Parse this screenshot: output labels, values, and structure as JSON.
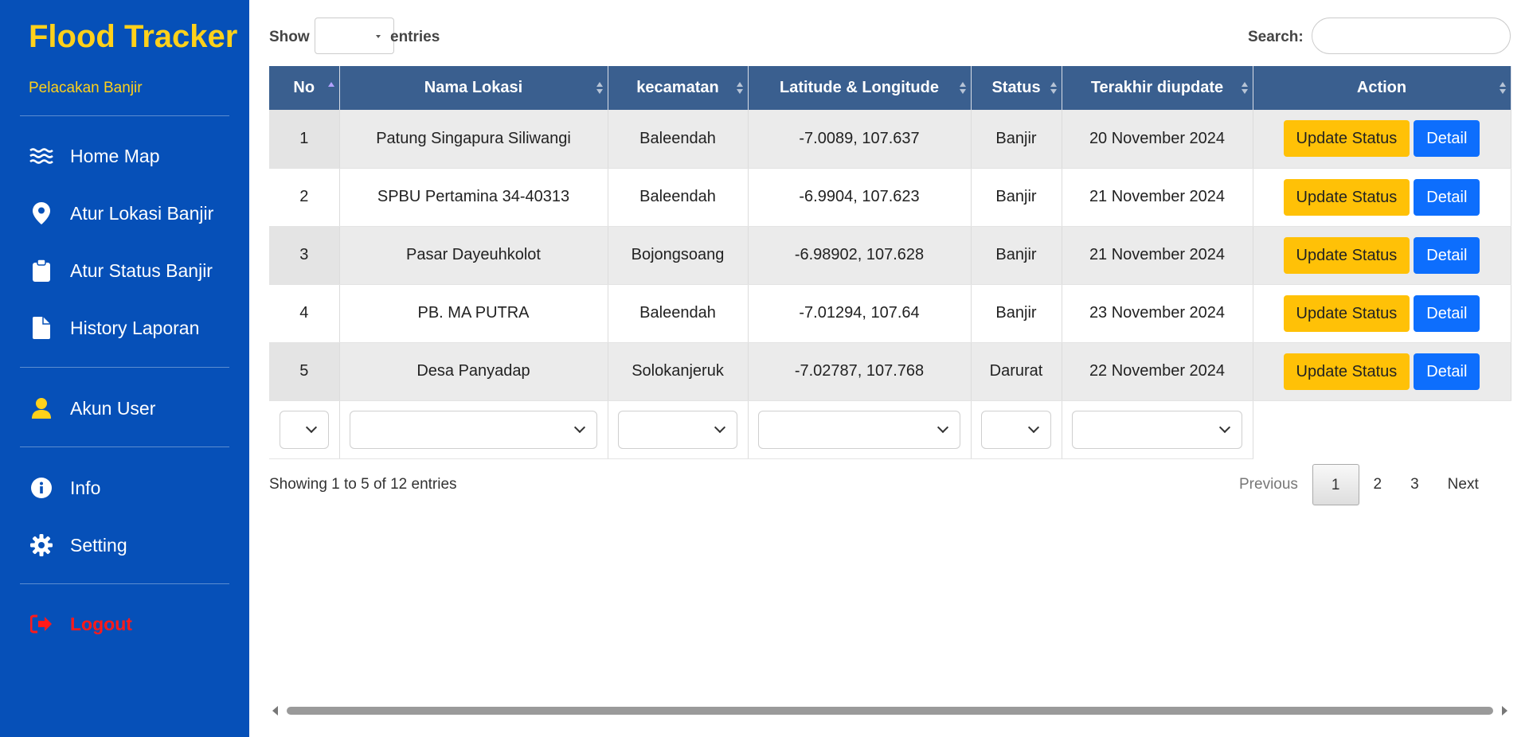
{
  "sidebar": {
    "brand": "Flood Tracker",
    "tagline": "Pelacakan Banjir",
    "items": [
      {
        "label": "Home Map",
        "icon": "water-waves-icon"
      },
      {
        "label": "Atur Lokasi Banjir",
        "icon": "location-pin-icon"
      },
      {
        "label": "Atur Status Banjir",
        "icon": "clipboard-icon"
      },
      {
        "label": "History Laporan",
        "icon": "document-icon"
      },
      {
        "label": "Akun User",
        "icon": "user-icon"
      },
      {
        "label": "Info",
        "icon": "info-circle-icon"
      },
      {
        "label": "Setting",
        "icon": "gear-icon"
      },
      {
        "label": "Logout",
        "icon": "sign-out-icon"
      }
    ],
    "colors": {
      "background": "#0650b8",
      "brand": "#ffd11a",
      "user_icon": "#ffd11a",
      "logout": "#ff1a1a"
    }
  },
  "table_controls": {
    "show_label": "Show",
    "entries_label": "entries",
    "page_length": "",
    "search_label": "Search:",
    "search_value": ""
  },
  "table": {
    "columns": [
      "No",
      "Nama Lokasi",
      "kecamatan",
      "Latitude & Longitude",
      "Status",
      "Terakhir diupdate",
      "Action"
    ],
    "rows": [
      {
        "no": "1",
        "nama_lokasi": "Patung Singapura Siliwangi",
        "kecamatan": "Baleendah",
        "latlong": "-7.0089, 107.637",
        "status": "Banjir",
        "updated": "20 November 2024"
      },
      {
        "no": "2",
        "nama_lokasi": "SPBU Pertamina 34-40313",
        "kecamatan": "Baleendah",
        "latlong": "-6.9904, 107.623",
        "status": "Banjir",
        "updated": "21 November 2024"
      },
      {
        "no": "3",
        "nama_lokasi": "Pasar Dayeuhkolot",
        "kecamatan": "Bojongsoang",
        "latlong": "-6.98902, 107.628",
        "status": "Banjir",
        "updated": "21 November 2024"
      },
      {
        "no": "4",
        "nama_lokasi": "PB. MA PUTRA",
        "kecamatan": "Baleendah",
        "latlong": "-7.01294, 107.64",
        "status": "Banjir",
        "updated": "23 November 2024"
      },
      {
        "no": "5",
        "nama_lokasi": "Desa Panyadap",
        "kecamatan": "Solokanjeruk",
        "latlong": "-7.02787, 107.768",
        "status": "Darurat",
        "updated": "22 November 2024"
      }
    ],
    "actions": {
      "update_label": "Update Status",
      "detail_label": "Detail"
    },
    "sorted_column": "No",
    "colors": {
      "header": "#3a5f8f",
      "update_button": "#ffc107",
      "detail_button": "#0d6efd"
    }
  },
  "footer": {
    "info": "Showing 1 to 5 of 12 entries",
    "pagination": {
      "previous": "Previous",
      "pages": [
        "1",
        "2",
        "3"
      ],
      "current": "1",
      "next": "Next"
    }
  }
}
